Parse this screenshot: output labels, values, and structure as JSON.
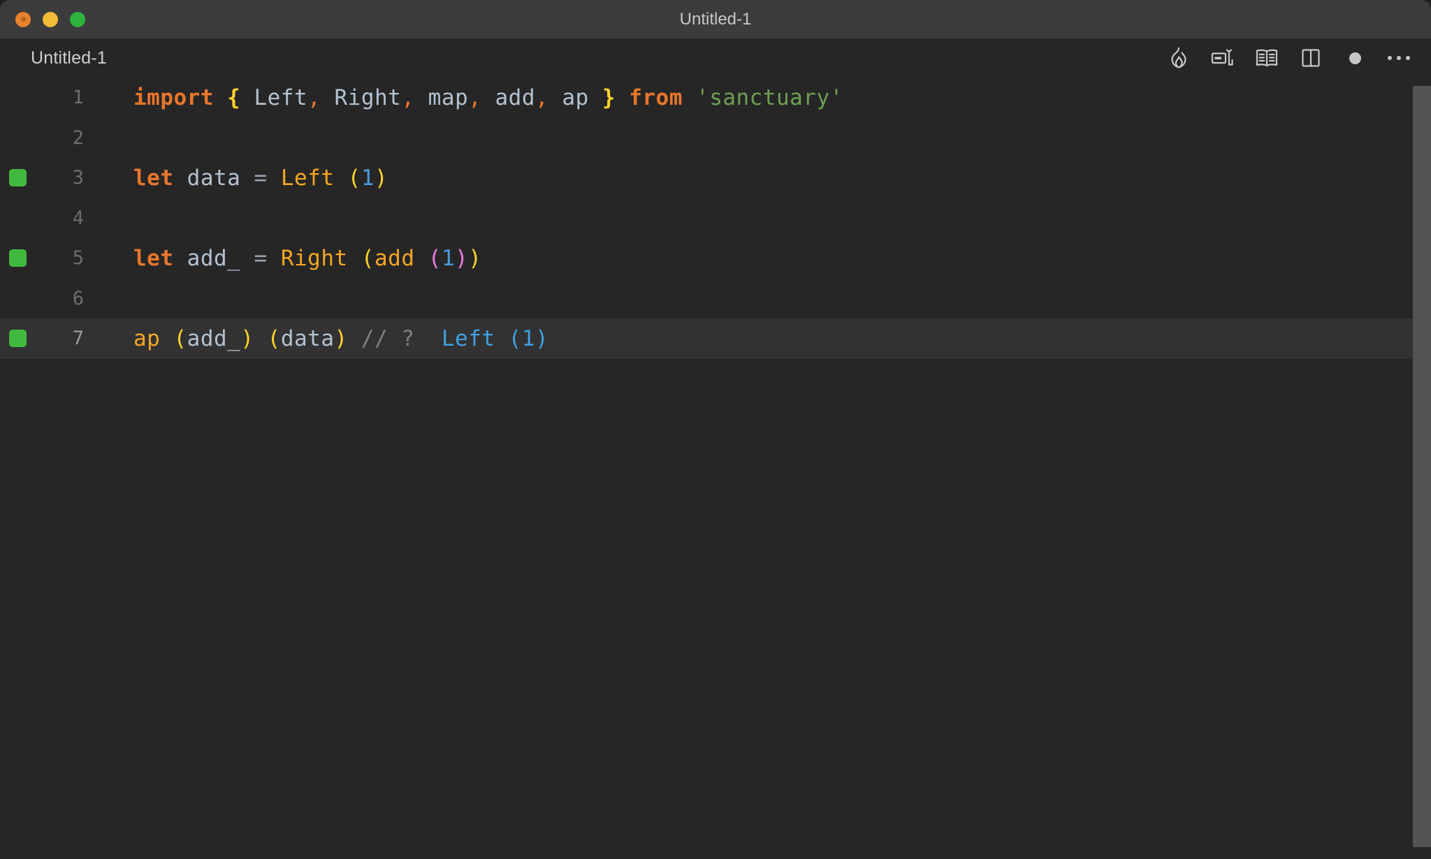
{
  "window": {
    "title": "Untitled-1",
    "traffic_lights": [
      {
        "name": "close",
        "color": "#e8822c"
      },
      {
        "name": "minimize",
        "color": "#f2bd36"
      },
      {
        "name": "maximize",
        "color": "#2cb33f"
      }
    ]
  },
  "tabbar": {
    "tab_label": "Untitled-1",
    "actions": [
      {
        "icon": "flame-icon",
        "label": "Run Quokka"
      },
      {
        "icon": "run-preview-icon",
        "label": "Run Code"
      },
      {
        "icon": "open-book-icon",
        "label": "Open Documentation"
      },
      {
        "icon": "split-editor-icon",
        "label": "Split Editor"
      },
      {
        "icon": "unsaved-dot-icon",
        "label": "Unsaved Changes"
      },
      {
        "icon": "ellipsis-icon",
        "label": "More Actions"
      }
    ]
  },
  "editor": {
    "language": "javascript",
    "active_line": 7,
    "colors": {
      "background": "#262626",
      "active_line": "#323232",
      "marker_green": "#41b93f",
      "keyword": "#e8762c",
      "identifier": "#b3c2d1",
      "string": "#6f9e54",
      "brace": "#ffd42a",
      "number": "#4a9bdd",
      "comment": "#808080",
      "result": "#3f9fe0",
      "scrollbar": "#545454"
    },
    "lines": [
      {
        "number": "1",
        "marker": false,
        "active": false,
        "tokens": [
          {
            "text": "import",
            "type": "kw"
          },
          {
            "text": " ",
            "type": "plain"
          },
          {
            "text": "{",
            "type": "brace"
          },
          {
            "text": " ",
            "type": "plain"
          },
          {
            "text": "Left",
            "type": "ident"
          },
          {
            "text": ",",
            "type": "punc"
          },
          {
            "text": " ",
            "type": "plain"
          },
          {
            "text": "Right",
            "type": "ident"
          },
          {
            "text": ",",
            "type": "punc"
          },
          {
            "text": " ",
            "type": "plain"
          },
          {
            "text": "map",
            "type": "ident"
          },
          {
            "text": ",",
            "type": "punc"
          },
          {
            "text": " ",
            "type": "plain"
          },
          {
            "text": "add",
            "type": "ident"
          },
          {
            "text": ",",
            "type": "punc"
          },
          {
            "text": " ",
            "type": "plain"
          },
          {
            "text": "ap",
            "type": "ident"
          },
          {
            "text": " ",
            "type": "plain"
          },
          {
            "text": "}",
            "type": "brace"
          },
          {
            "text": " ",
            "type": "plain"
          },
          {
            "text": "from",
            "type": "kw"
          },
          {
            "text": " ",
            "type": "plain"
          },
          {
            "text": "'sanctuary'",
            "type": "string"
          }
        ],
        "plain": "import { Left, Right, map, add, ap } from 'sanctuary'"
      },
      {
        "number": "2",
        "marker": false,
        "active": false,
        "tokens": [],
        "plain": ""
      },
      {
        "number": "3",
        "marker": true,
        "active": false,
        "tokens": [
          {
            "text": "let",
            "type": "kw"
          },
          {
            "text": " ",
            "type": "plain"
          },
          {
            "text": "data",
            "type": "ident"
          },
          {
            "text": " ",
            "type": "plain"
          },
          {
            "text": "=",
            "type": "op"
          },
          {
            "text": " ",
            "type": "plain"
          },
          {
            "text": "Left",
            "type": "func"
          },
          {
            "text": " ",
            "type": "plain"
          },
          {
            "text": "(",
            "type": "paren-y"
          },
          {
            "text": "1",
            "type": "num"
          },
          {
            "text": ")",
            "type": "paren-y"
          }
        ],
        "plain": "let data = Left (1)"
      },
      {
        "number": "4",
        "marker": false,
        "active": false,
        "tokens": [],
        "plain": ""
      },
      {
        "number": "5",
        "marker": true,
        "active": false,
        "tokens": [
          {
            "text": "let",
            "type": "kw"
          },
          {
            "text": " ",
            "type": "plain"
          },
          {
            "text": "add_",
            "type": "ident"
          },
          {
            "text": " ",
            "type": "plain"
          },
          {
            "text": "=",
            "type": "op"
          },
          {
            "text": " ",
            "type": "plain"
          },
          {
            "text": "Right",
            "type": "func"
          },
          {
            "text": " ",
            "type": "plain"
          },
          {
            "text": "(",
            "type": "paren-y"
          },
          {
            "text": "add",
            "type": "func"
          },
          {
            "text": " ",
            "type": "plain"
          },
          {
            "text": "(",
            "type": "paren-m"
          },
          {
            "text": "1",
            "type": "num"
          },
          {
            "text": ")",
            "type": "paren-m"
          },
          {
            "text": ")",
            "type": "paren-y"
          }
        ],
        "plain": "let add_ = Right (add (1))"
      },
      {
        "number": "6",
        "marker": false,
        "active": false,
        "tokens": [],
        "plain": ""
      },
      {
        "number": "7",
        "marker": true,
        "active": true,
        "tokens": [
          {
            "text": "ap",
            "type": "func"
          },
          {
            "text": " ",
            "type": "plain"
          },
          {
            "text": "(",
            "type": "paren-y"
          },
          {
            "text": "add_",
            "type": "ident"
          },
          {
            "text": ")",
            "type": "paren-y"
          },
          {
            "text": " ",
            "type": "plain"
          },
          {
            "text": "(",
            "type": "paren-y"
          },
          {
            "text": "data",
            "type": "ident"
          },
          {
            "text": ")",
            "type": "paren-y"
          },
          {
            "text": " ",
            "type": "plain"
          },
          {
            "text": "// ?",
            "type": "comment"
          },
          {
            "text": "  ",
            "type": "plain"
          },
          {
            "text": "Left (1)",
            "type": "result"
          }
        ],
        "plain": "ap (add_) (data) // ?  Left (1)"
      }
    ]
  }
}
